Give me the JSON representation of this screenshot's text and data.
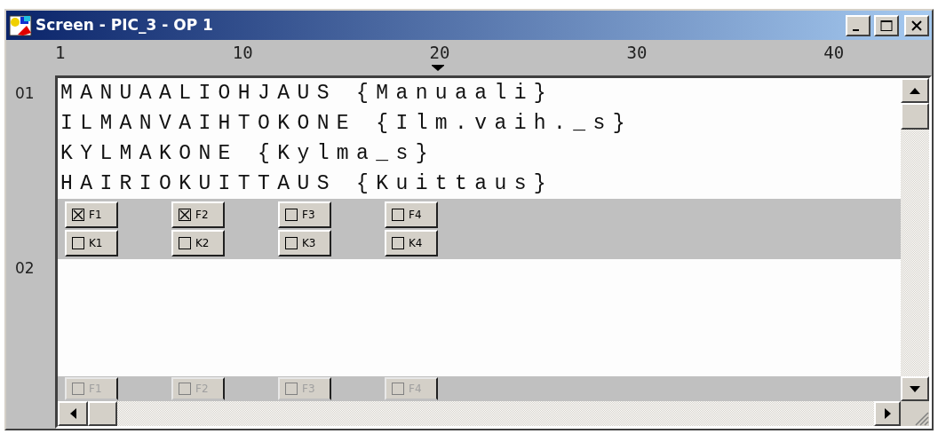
{
  "window": {
    "title": "Screen - PIC_3 - OP 1"
  },
  "ruler": [
    "1",
    "10",
    "20",
    "30",
    "40"
  ],
  "line_numbers": [
    "01",
    "02"
  ],
  "text_lines": [
    "MANUAALIOHJAUS {Manuaali}",
    "ILMANVAIHTOKONE {Ilm.vaih._s}",
    "KYLMAKONE {Kylma_s}",
    "HAIRIOKUITTAUS {Kuittaus}"
  ],
  "button_rows": [
    [
      {
        "label": "F1",
        "checked": true,
        "disabled": false
      },
      {
        "label": "F2",
        "checked": true,
        "disabled": false
      },
      {
        "label": "F3",
        "checked": false,
        "disabled": false
      },
      {
        "label": "F4",
        "checked": false,
        "disabled": false
      }
    ],
    [
      {
        "label": "K1",
        "checked": false,
        "disabled": false
      },
      {
        "label": "K2",
        "checked": false,
        "disabled": false
      },
      {
        "label": "K3",
        "checked": false,
        "disabled": false
      },
      {
        "label": "K4",
        "checked": false,
        "disabled": false
      }
    ]
  ],
  "bottom_buttons": [
    {
      "label": "F1",
      "checked": false,
      "disabled": true
    },
    {
      "label": "F2",
      "checked": false,
      "disabled": true
    },
    {
      "label": "F3",
      "checked": false,
      "disabled": true
    },
    {
      "label": "F4",
      "checked": false,
      "disabled": true
    }
  ]
}
